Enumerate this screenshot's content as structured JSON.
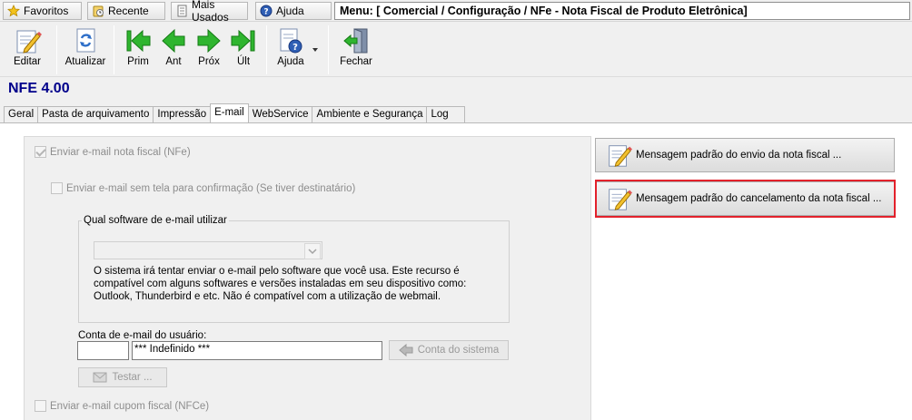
{
  "topbar": {
    "favoritos": "Favoritos",
    "recente": "Recente",
    "mais_usados": "Mais Usados",
    "ajuda": "Ajuda",
    "menu_path": "Menu: [ Comercial / Configuração / NFe - Nota Fiscal de Produto Eletrônica]"
  },
  "toolbar": {
    "editar": "Editar",
    "atualizar": "Atualizar",
    "prim": "Prim",
    "ant": "Ant",
    "prox": "Próx",
    "ult": "Últ",
    "ajuda": "Ajuda",
    "fechar": "Fechar"
  },
  "title": "NFE 4.00",
  "tabs": [
    "Geral",
    "Pasta de arquivamento",
    "Impressão",
    "E-mail",
    "WebService",
    "Ambiente e Segurança",
    "Log"
  ],
  "active_tab": "E-mail",
  "email": {
    "enviar_nfe": "Enviar e-mail nota fiscal (NFe)",
    "enviar_sem_tela": "Enviar e-mail sem tela para confirmação (Se tiver destinatário)",
    "software_group": "Qual software de e-mail utilizar",
    "info": "O sistema irá tentar enviar o e-mail pelo software que você usa. Este recurso é compatível com alguns softwares e versões instaladas em seu dispositivo como: Outlook, Thunderbird e etc. Não é compatível com a utilização de webmail.",
    "conta_label": "Conta de e-mail do usuário:",
    "conta_code": "",
    "conta_value": "*** Indefinido ***",
    "conta_sistema": "Conta do sistema",
    "testar": "Testar ...",
    "enviar_nfce": "Enviar e-mail cupom fiscal (NFCe)"
  },
  "right": {
    "msg_envio": "Mensagem padrão do envio da nota fiscal ...",
    "msg_cancelamento": "Mensagem padrão do cancelamento da nota fiscal ..."
  },
  "colors": {
    "highlight": "#e3212b",
    "title": "#00008b",
    "nav_green": "#2fb52f"
  }
}
